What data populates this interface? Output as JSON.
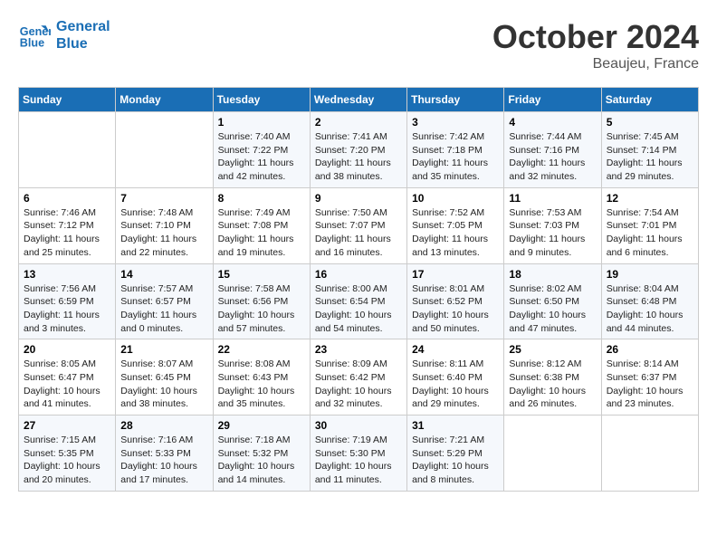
{
  "header": {
    "logo_line1": "General",
    "logo_line2": "Blue",
    "month": "October 2024",
    "location": "Beaujeu, France"
  },
  "weekdays": [
    "Sunday",
    "Monday",
    "Tuesday",
    "Wednesday",
    "Thursday",
    "Friday",
    "Saturday"
  ],
  "weeks": [
    [
      {
        "day": "",
        "text": ""
      },
      {
        "day": "",
        "text": ""
      },
      {
        "day": "1",
        "text": "Sunrise: 7:40 AM\nSunset: 7:22 PM\nDaylight: 11 hours and 42 minutes."
      },
      {
        "day": "2",
        "text": "Sunrise: 7:41 AM\nSunset: 7:20 PM\nDaylight: 11 hours and 38 minutes."
      },
      {
        "day": "3",
        "text": "Sunrise: 7:42 AM\nSunset: 7:18 PM\nDaylight: 11 hours and 35 minutes."
      },
      {
        "day": "4",
        "text": "Sunrise: 7:44 AM\nSunset: 7:16 PM\nDaylight: 11 hours and 32 minutes."
      },
      {
        "day": "5",
        "text": "Sunrise: 7:45 AM\nSunset: 7:14 PM\nDaylight: 11 hours and 29 minutes."
      }
    ],
    [
      {
        "day": "6",
        "text": "Sunrise: 7:46 AM\nSunset: 7:12 PM\nDaylight: 11 hours and 25 minutes."
      },
      {
        "day": "7",
        "text": "Sunrise: 7:48 AM\nSunset: 7:10 PM\nDaylight: 11 hours and 22 minutes."
      },
      {
        "day": "8",
        "text": "Sunrise: 7:49 AM\nSunset: 7:08 PM\nDaylight: 11 hours and 19 minutes."
      },
      {
        "day": "9",
        "text": "Sunrise: 7:50 AM\nSunset: 7:07 PM\nDaylight: 11 hours and 16 minutes."
      },
      {
        "day": "10",
        "text": "Sunrise: 7:52 AM\nSunset: 7:05 PM\nDaylight: 11 hours and 13 minutes."
      },
      {
        "day": "11",
        "text": "Sunrise: 7:53 AM\nSunset: 7:03 PM\nDaylight: 11 hours and 9 minutes."
      },
      {
        "day": "12",
        "text": "Sunrise: 7:54 AM\nSunset: 7:01 PM\nDaylight: 11 hours and 6 minutes."
      }
    ],
    [
      {
        "day": "13",
        "text": "Sunrise: 7:56 AM\nSunset: 6:59 PM\nDaylight: 11 hours and 3 minutes."
      },
      {
        "day": "14",
        "text": "Sunrise: 7:57 AM\nSunset: 6:57 PM\nDaylight: 11 hours and 0 minutes."
      },
      {
        "day": "15",
        "text": "Sunrise: 7:58 AM\nSunset: 6:56 PM\nDaylight: 10 hours and 57 minutes."
      },
      {
        "day": "16",
        "text": "Sunrise: 8:00 AM\nSunset: 6:54 PM\nDaylight: 10 hours and 54 minutes."
      },
      {
        "day": "17",
        "text": "Sunrise: 8:01 AM\nSunset: 6:52 PM\nDaylight: 10 hours and 50 minutes."
      },
      {
        "day": "18",
        "text": "Sunrise: 8:02 AM\nSunset: 6:50 PM\nDaylight: 10 hours and 47 minutes."
      },
      {
        "day": "19",
        "text": "Sunrise: 8:04 AM\nSunset: 6:48 PM\nDaylight: 10 hours and 44 minutes."
      }
    ],
    [
      {
        "day": "20",
        "text": "Sunrise: 8:05 AM\nSunset: 6:47 PM\nDaylight: 10 hours and 41 minutes."
      },
      {
        "day": "21",
        "text": "Sunrise: 8:07 AM\nSunset: 6:45 PM\nDaylight: 10 hours and 38 minutes."
      },
      {
        "day": "22",
        "text": "Sunrise: 8:08 AM\nSunset: 6:43 PM\nDaylight: 10 hours and 35 minutes."
      },
      {
        "day": "23",
        "text": "Sunrise: 8:09 AM\nSunset: 6:42 PM\nDaylight: 10 hours and 32 minutes."
      },
      {
        "day": "24",
        "text": "Sunrise: 8:11 AM\nSunset: 6:40 PM\nDaylight: 10 hours and 29 minutes."
      },
      {
        "day": "25",
        "text": "Sunrise: 8:12 AM\nSunset: 6:38 PM\nDaylight: 10 hours and 26 minutes."
      },
      {
        "day": "26",
        "text": "Sunrise: 8:14 AM\nSunset: 6:37 PM\nDaylight: 10 hours and 23 minutes."
      }
    ],
    [
      {
        "day": "27",
        "text": "Sunrise: 7:15 AM\nSunset: 5:35 PM\nDaylight: 10 hours and 20 minutes."
      },
      {
        "day": "28",
        "text": "Sunrise: 7:16 AM\nSunset: 5:33 PM\nDaylight: 10 hours and 17 minutes."
      },
      {
        "day": "29",
        "text": "Sunrise: 7:18 AM\nSunset: 5:32 PM\nDaylight: 10 hours and 14 minutes."
      },
      {
        "day": "30",
        "text": "Sunrise: 7:19 AM\nSunset: 5:30 PM\nDaylight: 10 hours and 11 minutes."
      },
      {
        "day": "31",
        "text": "Sunrise: 7:21 AM\nSunset: 5:29 PM\nDaylight: 10 hours and 8 minutes."
      },
      {
        "day": "",
        "text": ""
      },
      {
        "day": "",
        "text": ""
      }
    ]
  ]
}
